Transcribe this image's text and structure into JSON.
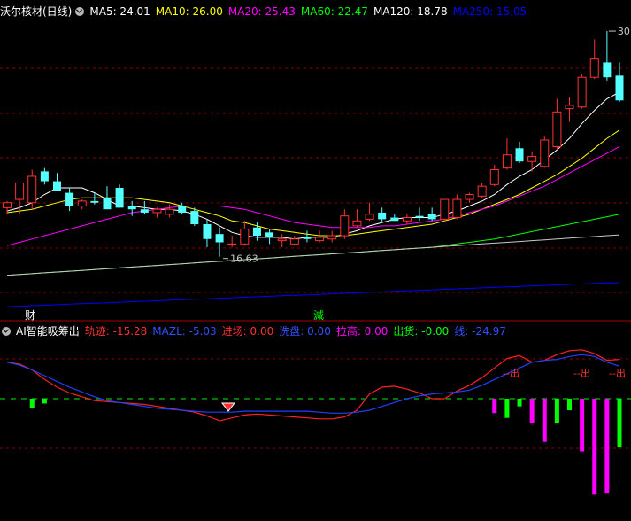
{
  "main_header": {
    "title": "沃尔核材(日线)",
    "indicators": [
      {
        "label": "MA5",
        "value": "24.01",
        "color": "#ffffff"
      },
      {
        "label": "MA10",
        "value": "26.00",
        "color": "#ffff00"
      },
      {
        "label": "MA20",
        "value": "25.43",
        "color": "#ff00ff"
      },
      {
        "label": "MA60",
        "value": "22.47",
        "color": "#00ff00"
      },
      {
        "label": "MA120",
        "value": "18.78",
        "color": "#ffffff"
      },
      {
        "label": "MA250",
        "value": "15.05",
        "color": "#0000ff"
      }
    ]
  },
  "sub_header": {
    "title": "AI智能吸筹出",
    "indicators": [
      {
        "label": "轨迹",
        "value": "-15.28",
        "color": "#ff3030"
      },
      {
        "label": "MAZL",
        "value": "-5.03",
        "color": "#3050ff"
      },
      {
        "label": "进场",
        "value": "0.00",
        "color": "#ff3030"
      },
      {
        "label": "洗盘",
        "value": "0.00",
        "color": "#3050ff"
      },
      {
        "label": "拉高",
        "value": "0.00",
        "color": "#ff00ff"
      },
      {
        "label": "出货",
        "value": "-0.00",
        "color": "#00ff00"
      },
      {
        "label": "线",
        "value": "-24.97",
        "color": "#3050ff"
      }
    ]
  },
  "labels": {
    "low_price": "16.63",
    "high_price": "30",
    "cai_marker": "财",
    "jian_marker": "減",
    "sell_signal": "出"
  },
  "colors": {
    "up_candle": "#ff3232",
    "down_candle": "#54ffff",
    "grid": "#8b0000",
    "trace": "#ff2020",
    "mazl": "#2040ff",
    "pull": "#ff00ff",
    "ship": "#00ff00"
  },
  "chart_data": [
    {
      "type": "candlestick",
      "title": "沃尔核材(日线)",
      "x": [
        1,
        2,
        3,
        4,
        5,
        6,
        7,
        8,
        9,
        10,
        11,
        12,
        13,
        14,
        15,
        16,
        17,
        18,
        19,
        20,
        21,
        22,
        23,
        24,
        25,
        26,
        27,
        28,
        29,
        30,
        31,
        32,
        33,
        34,
        35,
        36,
        37,
        38,
        39,
        40,
        41,
        42,
        43,
        44,
        45,
        46,
        47,
        48,
        49,
        50
      ],
      "open": [
        19.6,
        20.1,
        19.9,
        21.8,
        21.2,
        20.5,
        19.7,
        20.0,
        20.2,
        20.8,
        19.7,
        19.5,
        19.3,
        19.2,
        19.7,
        19.4,
        18.6,
        18.0,
        17.4,
        17.4,
        18.4,
        18.1,
        17.6,
        17.4,
        17.8,
        17.6,
        17.7,
        17.9,
        18.5,
        18.9,
        19.3,
        19.0,
        18.8,
        19.1,
        19.2,
        18.9,
        19.0,
        20.1,
        20.3,
        21.0,
        22.0,
        23.2,
        22.4,
        22.1,
        23.3,
        25.6,
        25.7,
        27.5,
        28.4,
        27.6
      ],
      "high": [
        20.0,
        20.8,
        21.9,
        22.0,
        21.7,
        20.8,
        20.1,
        20.5,
        20.9,
        21.0,
        20.0,
        20.0,
        19.6,
        19.8,
        19.9,
        19.6,
        18.9,
        18.4,
        17.9,
        18.8,
        18.7,
        18.3,
        18.0,
        17.9,
        18.2,
        18.2,
        18.2,
        19.5,
        19.5,
        19.9,
        19.6,
        19.2,
        19.2,
        19.6,
        19.6,
        20.1,
        20.4,
        20.5,
        21.1,
        22.2,
        23.8,
        23.6,
        23.0,
        23.9,
        26.2,
        26.3,
        27.7,
        29.8,
        30.3,
        28.4
      ],
      "low": [
        19.2,
        19.2,
        19.5,
        21.0,
        20.7,
        19.4,
        19.5,
        19.8,
        19.9,
        19.6,
        19.1,
        19.2,
        19.0,
        19.0,
        19.2,
        18.5,
        17.2,
        16.63,
        17.2,
        17.3,
        17.6,
        17.4,
        17.2,
        17.3,
        17.5,
        17.5,
        17.5,
        17.7,
        18.4,
        18.8,
        18.7,
        18.8,
        18.6,
        18.8,
        18.8,
        18.8,
        18.9,
        19.9,
        20.2,
        20.9,
        21.9,
        22.3,
        21.8,
        22.0,
        23.1,
        24.8,
        25.6,
        27.4,
        27.3,
        26.0
      ],
      "close": [
        19.9,
        21.1,
        21.5,
        21.2,
        20.6,
        19.7,
        20.0,
        19.9,
        19.5,
        19.6,
        19.5,
        19.3,
        19.5,
        19.5,
        19.3,
        18.6,
        17.7,
        17.5,
        17.4,
        18.3,
        17.9,
        17.8,
        17.7,
        17.7,
        17.7,
        17.8,
        17.9,
        19.1,
        18.8,
        19.2,
        18.9,
        18.8,
        19.0,
        19.0,
        18.9,
        20.1,
        20.1,
        20.4,
        20.9,
        21.9,
        22.8,
        22.4,
        22.7,
        23.7,
        25.4,
        25.8,
        27.5,
        28.6,
        27.5,
        26.1
      ],
      "ylim": [
        13.5,
        31
      ],
      "ma": [
        {
          "name": "MA5",
          "values": [
            19.4,
            19.6,
            19.9,
            20.4,
            20.8,
            20.8,
            20.8,
            20.5,
            20.1,
            19.7,
            19.7,
            19.6,
            19.5,
            19.5,
            19.4,
            19.2,
            18.9,
            18.5,
            18.1,
            17.9,
            17.8,
            17.8,
            17.8,
            17.7,
            17.8,
            17.8,
            17.8,
            18.0,
            18.2,
            18.5,
            18.7,
            18.9,
            19.0,
            19.0,
            19.0,
            19.2,
            19.4,
            19.7,
            20.0,
            20.4,
            21.0,
            21.5,
            21.9,
            22.5,
            23.1,
            23.8,
            24.7,
            25.5,
            26.2,
            26.6
          ]
        },
        {
          "name": "MA10",
          "values": [
            19.3,
            19.4,
            19.5,
            19.7,
            19.9,
            20.1,
            20.2,
            20.2,
            20.2,
            20.2,
            20.2,
            20.1,
            20.0,
            19.9,
            19.7,
            19.5,
            19.3,
            19.1,
            18.8,
            18.7,
            18.5,
            18.3,
            18.2,
            18.1,
            18.0,
            17.9,
            17.9,
            17.9,
            18.0,
            18.1,
            18.2,
            18.3,
            18.4,
            18.5,
            18.6,
            18.8,
            19.0,
            19.2,
            19.5,
            19.8,
            20.1,
            20.4,
            20.8,
            21.2,
            21.6,
            22.1,
            22.6,
            23.2,
            23.8,
            24.3
          ]
        },
        {
          "name": "MA20",
          "values": [
            17.3,
            17.5,
            17.7,
            17.9,
            18.1,
            18.3,
            18.5,
            18.7,
            18.9,
            19.1,
            19.3,
            19.4,
            19.5,
            19.6,
            19.7,
            19.7,
            19.7,
            19.7,
            19.6,
            19.5,
            19.3,
            19.1,
            18.9,
            18.7,
            18.6,
            18.5,
            18.4,
            18.4,
            18.4,
            18.4,
            18.5,
            18.5,
            18.6,
            18.7,
            18.8,
            18.9,
            19.1,
            19.3,
            19.5,
            19.7,
            20.0,
            20.3,
            20.6,
            20.9,
            21.3,
            21.7,
            22.1,
            22.5,
            22.9,
            23.3
          ]
        },
        {
          "name": "MA60",
          "values": [
            15.5,
            15.55,
            15.6,
            15.65,
            15.7,
            15.75,
            15.8,
            15.85,
            15.9,
            15.95,
            16.0,
            16.05,
            16.1,
            16.15,
            16.2,
            16.25,
            16.3,
            16.35,
            16.4,
            16.45,
            16.5,
            16.55,
            16.6,
            16.65,
            16.7,
            16.75,
            16.8,
            16.85,
            16.9,
            16.95,
            17.0,
            17.05,
            17.1,
            17.15,
            17.2,
            17.3,
            17.4,
            17.5,
            17.6,
            17.7,
            17.85,
            18.0,
            18.15,
            18.3,
            18.45,
            18.6,
            18.75,
            18.9,
            19.05,
            19.2
          ]
        },
        {
          "name": "MA120",
          "values": [
            15.5,
            15.55,
            15.6,
            15.65,
            15.7,
            15.75,
            15.8,
            15.85,
            15.9,
            15.95,
            16.0,
            16.05,
            16.1,
            16.15,
            16.2,
            16.25,
            16.3,
            16.35,
            16.4,
            16.45,
            16.5,
            16.55,
            16.6,
            16.65,
            16.7,
            16.75,
            16.8,
            16.85,
            16.9,
            16.95,
            17.0,
            17.05,
            17.1,
            17.15,
            17.2,
            17.25,
            17.3,
            17.35,
            17.4,
            17.45,
            17.5,
            17.55,
            17.6,
            17.65,
            17.7,
            17.75,
            17.8,
            17.85,
            17.9,
            17.95
          ]
        },
        {
          "name": "MA250",
          "values": [
            13.6,
            13.63,
            13.66,
            13.69,
            13.72,
            13.75,
            13.78,
            13.81,
            13.84,
            13.87,
            13.9,
            13.93,
            13.96,
            13.99,
            14.02,
            14.05,
            14.08,
            14.11,
            14.14,
            14.17,
            14.2,
            14.23,
            14.26,
            14.29,
            14.32,
            14.35,
            14.38,
            14.41,
            14.44,
            14.47,
            14.5,
            14.53,
            14.56,
            14.59,
            14.62,
            14.65,
            14.68,
            14.71,
            14.74,
            14.77,
            14.8,
            14.83,
            14.86,
            14.89,
            14.92,
            14.95,
            14.98,
            15.01,
            15.04,
            15.05
          ]
        }
      ]
    },
    {
      "type": "line",
      "title": "AI智能吸筹出",
      "x": [
        1,
        2,
        3,
        4,
        5,
        6,
        7,
        8,
        9,
        10,
        11,
        12,
        13,
        14,
        15,
        16,
        17,
        18,
        19,
        20,
        21,
        22,
        23,
        24,
        25,
        26,
        27,
        28,
        29,
        30,
        31,
        32,
        33,
        34,
        35,
        36,
        37,
        38,
        39,
        40,
        41,
        42,
        43,
        44,
        45,
        46,
        47,
        48,
        49,
        50
      ],
      "ylim": [
        -120,
        60
      ],
      "series": [
        {
          "name": "轨迹",
          "values": [
            38,
            36,
            30,
            20,
            12,
            6,
            2,
            -2,
            -3,
            -4,
            -5,
            -6,
            -8,
            -10,
            -12,
            -14,
            -18,
            -23,
            -20,
            -17,
            -16,
            -17,
            -18,
            -19,
            -20,
            -21,
            -21,
            -19,
            -12,
            5,
            12,
            13,
            10,
            6,
            0,
            0,
            8,
            14,
            22,
            32,
            42,
            45,
            38,
            40,
            46,
            50,
            51,
            47,
            40,
            41
          ]
        },
        {
          "name": "MAZL",
          "values": [
            38,
            35,
            30,
            24,
            18,
            12,
            7,
            2,
            -2,
            -4,
            -6,
            -8,
            -10,
            -11,
            -12,
            -13,
            -14,
            -14,
            -14,
            -13,
            -13,
            -13,
            -13,
            -13,
            -13,
            -14,
            -15,
            -15,
            -14,
            -12,
            -8,
            -4,
            0,
            3,
            5,
            6,
            7,
            9,
            14,
            20,
            26,
            32,
            38,
            40,
            41,
            44,
            46,
            44,
            38,
            34
          ]
        },
        {
          "name": "拉高",
          "values": [
            0,
            0,
            0,
            0,
            0,
            0,
            0,
            0,
            0,
            0,
            0,
            0,
            0,
            0,
            0,
            0,
            0,
            0,
            0,
            0,
            0,
            0,
            0,
            0,
            0,
            0,
            0,
            0,
            0,
            0,
            0,
            0,
            0,
            0,
            0,
            0,
            0,
            0,
            0,
            -15,
            0,
            0,
            -25,
            -45,
            0,
            0,
            -55,
            -100,
            -98,
            0
          ]
        },
        {
          "name": "出货",
          "values": [
            0,
            0,
            -10,
            -5,
            0,
            0,
            0,
            0,
            0,
            0,
            0,
            0,
            0,
            0,
            0,
            0,
            0,
            0,
            0,
            0,
            0,
            0,
            0,
            0,
            0,
            0,
            0,
            0,
            0,
            0,
            0,
            0,
            0,
            0,
            0,
            0,
            0,
            0,
            0,
            0,
            -20,
            -8,
            0,
            0,
            -25,
            -12,
            0,
            0,
            0,
            -50
          ]
        }
      ]
    }
  ]
}
